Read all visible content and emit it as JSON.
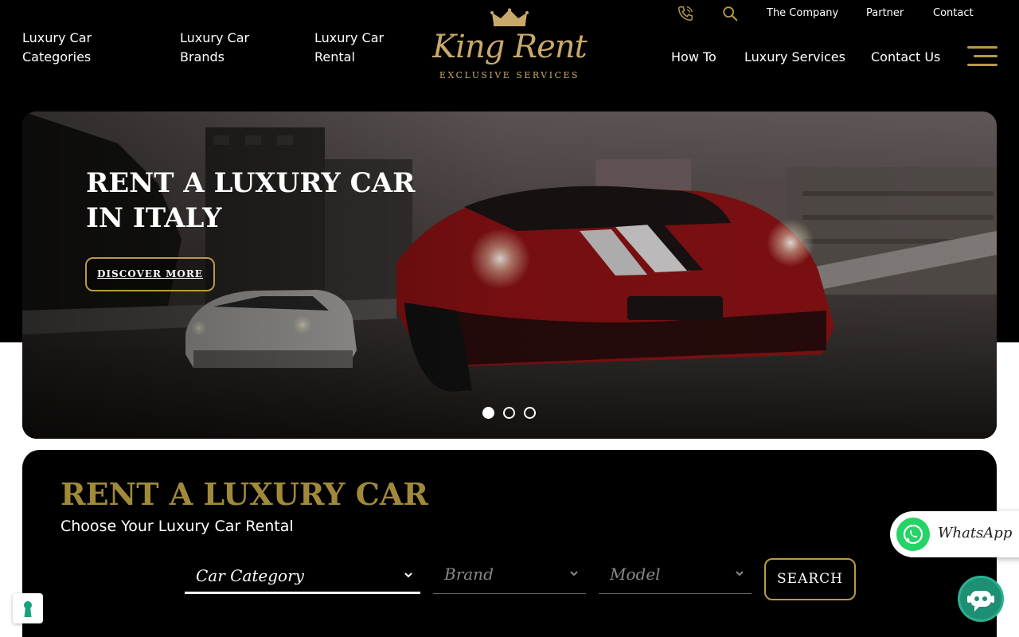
{
  "header": {
    "nav_left": [
      {
        "line1": "Luxury Car",
        "line2": "Categories"
      },
      {
        "line1": "Luxury Car",
        "line2": "Brands"
      },
      {
        "line1": "Luxury Car",
        "line2": "Rental"
      }
    ],
    "logo": {
      "name": "King Rent",
      "tagline": "EXCLUSIVE SERVICES",
      "icon": "crown-icon"
    },
    "utility": {
      "phone_icon": "phone-icon",
      "search_icon": "search-icon",
      "links": [
        "The Company",
        "Partner",
        "Contact"
      ]
    },
    "nav_right": [
      "How To",
      "Luxury Services",
      "Contact Us"
    ],
    "menu_icon": "hamburger-menu-icon"
  },
  "hero": {
    "title_line1": "RENT A LUXURY CAR",
    "title_line2": "IN ITALY",
    "cta": "DISCOVER MORE",
    "slides": 3,
    "active_slide": 1
  },
  "search": {
    "title": "RENT A LUXURY CAR",
    "subtitle": "Choose Your Luxury Car Rental",
    "fields": [
      {
        "label": "Car Category",
        "active": true
      },
      {
        "label": "Brand",
        "active": false
      },
      {
        "label": "Model",
        "active": false
      }
    ],
    "button": "SEARCH"
  },
  "floating": {
    "whatsapp": "WhatsApp",
    "chatbot_icon": "chatbot-icon",
    "privacy_icon": "keyhole-icon"
  },
  "colors": {
    "gold": "#b99a45",
    "title_gold": "#a08a3a",
    "whatsapp_green": "#25d366",
    "chatbot_green": "#1d8f73"
  }
}
